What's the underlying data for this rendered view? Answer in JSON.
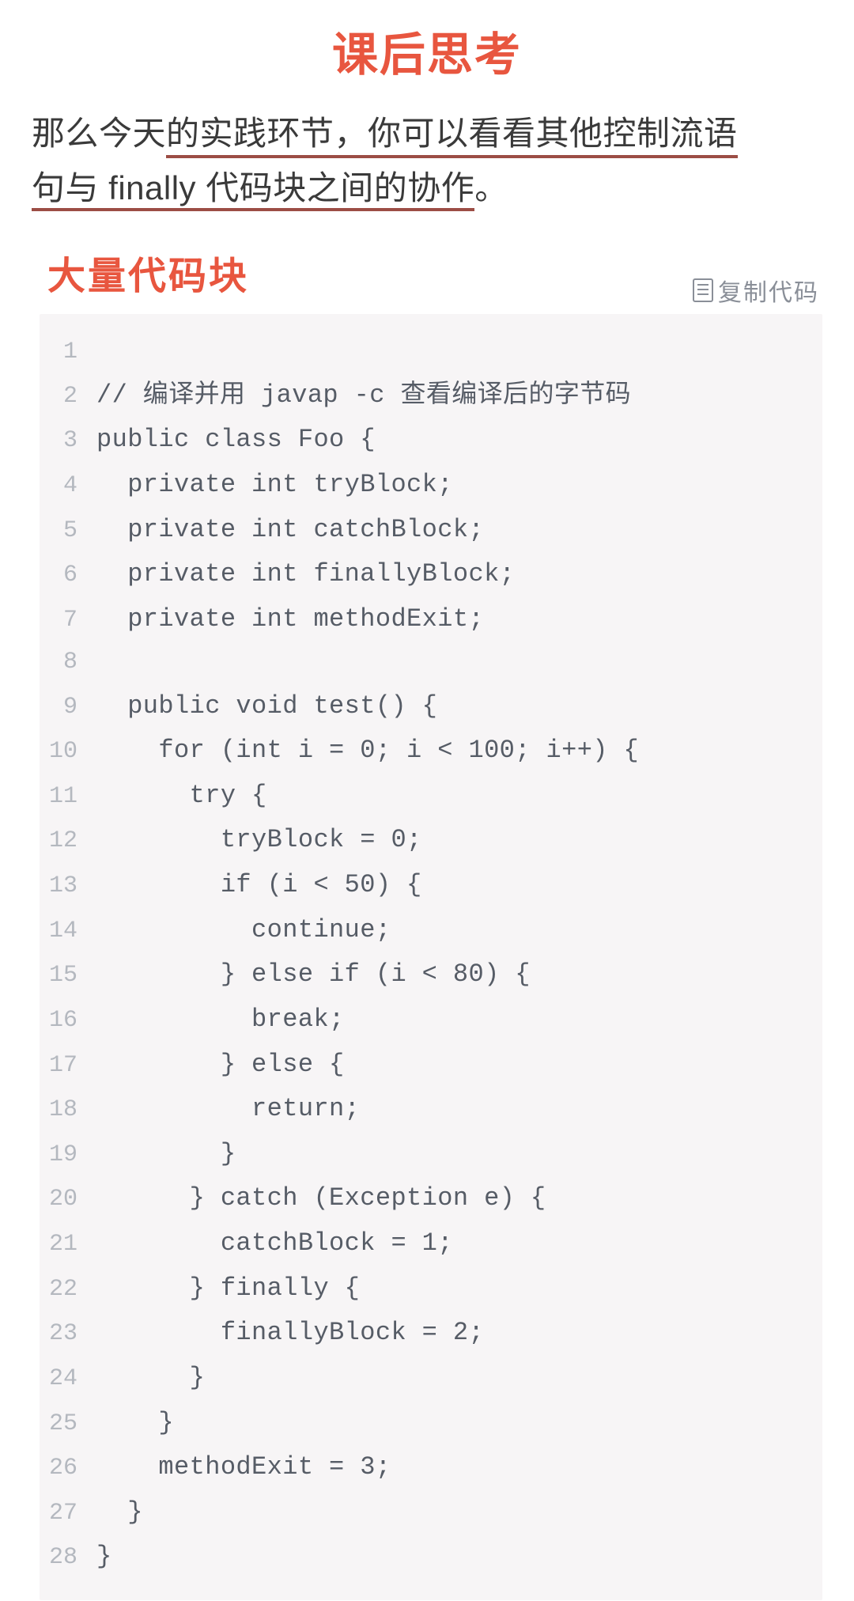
{
  "title": "课后思考",
  "intro": {
    "pre": "那么今天",
    "u1": "的实践环节，你可以看看其他控制流语",
    "u2": "句与 finally 代码块之间的协作",
    "tail": "。"
  },
  "code_section": {
    "heading": "大量代码块",
    "copy_label": "复制代码"
  },
  "code_lines": [
    "",
    "// 编译并用 javap -c 查看编译后的字节码",
    "public class Foo {",
    "  private int tryBlock;",
    "  private int catchBlock;",
    "  private int finallyBlock;",
    "  private int methodExit;",
    "",
    "  public void test() {",
    "    for (int i = 0; i < 100; i++) {",
    "      try {",
    "        tryBlock = 0;",
    "        if (i < 50) {",
    "          continue;",
    "        } else if (i < 80) {",
    "          break;",
    "        } else {",
    "          return;",
    "        }",
    "      } catch (Exception e) {",
    "        catchBlock = 1;",
    "      } finally {",
    "        finallyBlock = 2;",
    "      }",
    "    }",
    "    methodExit = 3;",
    "  }",
    "}"
  ]
}
